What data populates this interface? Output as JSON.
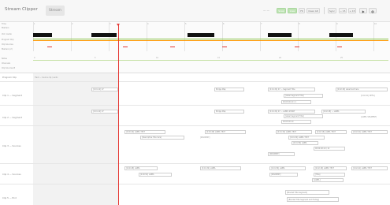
{
  "toolbar": {
    "title": "Stream Clipper",
    "tab_label": "Stream",
    "zoom_label": "— —",
    "buttons": [
      "Snap",
      "Live",
      "Fit",
      "Clear Alt",
      "Sync",
      "− 15",
      "+ 15"
    ],
    "icons": [
      "play-icon",
      "settings-icon"
    ]
  },
  "timeline": {
    "row_labels": [
      "Time",
      "Markers",
      "Vid / Audio",
      "Program Clip",
      "Clip Sources",
      "Markers (2)",
      "Notes",
      "Channels",
      "Clip Sources B",
      "Markers (B)"
    ],
    "ticks": [
      "1",
      "2",
      "3",
      "4",
      "5",
      "6",
      "7",
      "8",
      "9",
      "10",
      "11",
      "12"
    ],
    "lower_ticks": [
      "0",
      "5",
      "10",
      "15",
      "20",
      "25",
      "30"
    ],
    "colors": {
      "black_blocks": "#111111",
      "green_track": "#8bc34a",
      "orange_track": "#ff9800",
      "red_marker": "#e53935",
      "light_green": "#c5e1a5"
    }
  },
  "tracks": [
    {
      "label": "Program Clip",
      "header_note": "Track — Source clip / audio"
    },
    {
      "label": "Clip 1 — Segment",
      "boxes": [
        "[0:01:12] 07",
        "Bridge Map",
        "[0:01:34] 07 — Segment Title",
        "[0:02:18] Label text here",
        "[Label Segment Title]",
        "00:03:00:10 / 1",
        "[0:02:41] DEFG]"
      ]
    },
    {
      "label": "Clip 2 — Segment",
      "boxes": [
        "[0:01:12] 07",
        "Bridge Map",
        "[0:01:34] 07 — LABEL SHORT",
        "[0:02:18] — LABEL",
        "[Label Segment Title]",
        "00:03:00:10",
        "[LABEL SEGMENT]"
      ]
    },
    {
      "label": "Clip 3 — Sources",
      "boxes": [
        "[0:00:44] LABEL TEXT",
        "[0:00:48] LABEL TEXT",
        "[0:01:34] LABEL TEXT",
        "[0:02:18] LABEL TEXT",
        "[0:02:41] LABEL TEXT",
        "[Descriptive Title here]",
        "[SEGMENT]",
        "[0:01:34] LABEL TEXT",
        "[0:01:56] LABEL",
        "00:02:48:10 / 12",
        "[SEGMENT]"
      ]
    },
    {
      "label": "Clip 4 — Sources",
      "boxes": [
        "[0:00:48] LABEL",
        "[0:00:52] LABEL",
        "[0:01:34] LABEL",
        "[0:01:56] LABEL",
        "[0:02:18] LABEL TEXT",
        "[0:02:41] LABEL TEXT",
        "[SEGMENT]",
        "[Title]",
        "[LABEL]"
      ]
    },
    {
      "label": "Clip 5 — End",
      "boxes": [
        "[Bracket Title Segment]",
        "[Bracket Title Segment and Ending]"
      ]
    }
  ]
}
